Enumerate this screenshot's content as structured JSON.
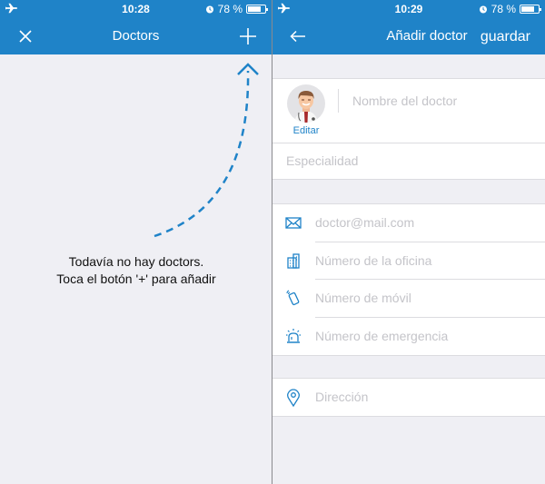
{
  "left_screen": {
    "status_bar": {
      "time": "10:28",
      "battery": "78 %",
      "battery_level": 0.78
    },
    "nav": {
      "title": "Doctors",
      "close_icon": "close-icon",
      "add_icon": "plus-icon"
    },
    "empty_state": {
      "line1": "Todavía no hay doctors.",
      "line2": "Toca el botón '+' para añadir",
      "arrow_icon": "dashed-arrow-up-icon"
    }
  },
  "right_screen": {
    "status_bar": {
      "time": "10:29",
      "battery": "78 %",
      "battery_level": 0.78
    },
    "nav": {
      "title": "Añadir doctor",
      "back_icon": "arrow-left-icon",
      "save_label": "guardar"
    },
    "profile": {
      "avatar": "doctor-avatar",
      "edit_label": "Editar",
      "name_placeholder": "Nombre del doctor",
      "specialty_placeholder": "Especialidad"
    },
    "contact_fields": [
      {
        "icon": "mail-icon",
        "placeholder": "doctor@mail.com"
      },
      {
        "icon": "office-building-icon",
        "placeholder": "Número de la oficina"
      },
      {
        "icon": "mobile-phone-icon",
        "placeholder": "Número de móvil"
      },
      {
        "icon": "emergency-siren-icon",
        "placeholder": "Número de emergencia"
      }
    ],
    "address": {
      "icon": "location-pin-icon",
      "placeholder": "Dirección"
    }
  },
  "colors": {
    "primary": "#1f83c8",
    "background": "#efeff4",
    "placeholder": "#c4c4c9",
    "separator": "#dcdce0"
  }
}
